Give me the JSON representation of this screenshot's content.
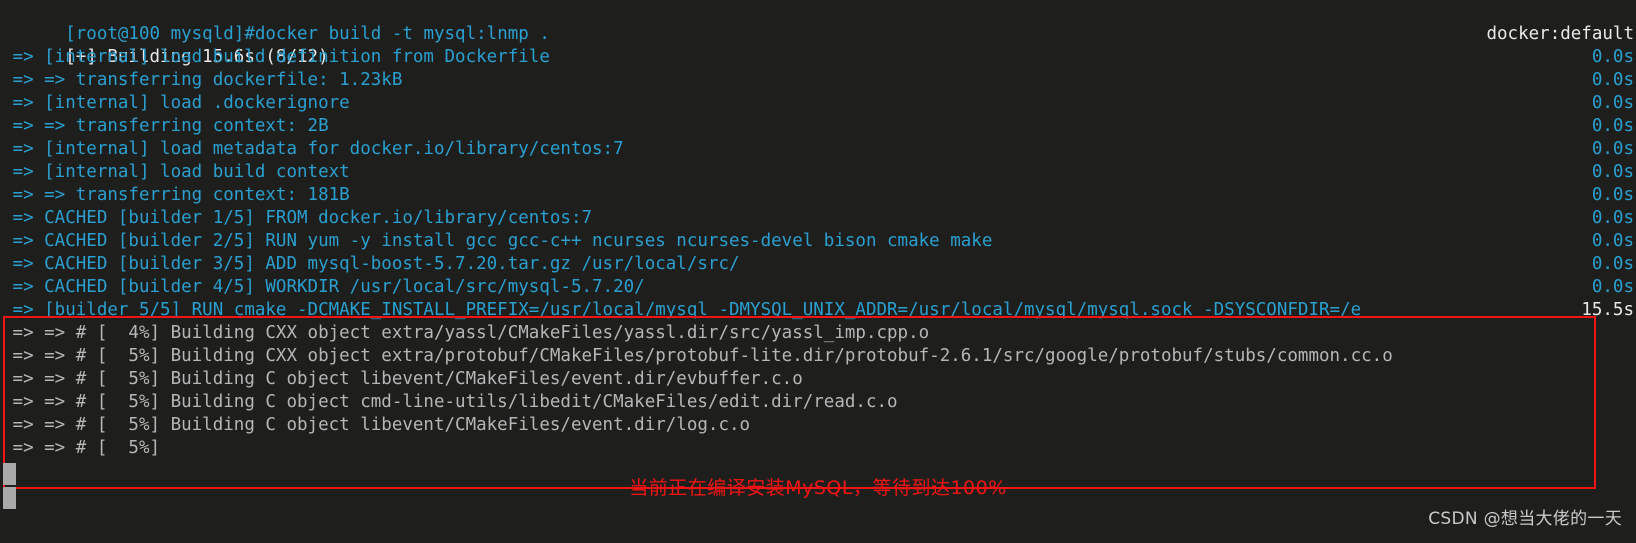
{
  "terminal": {
    "colors": {
      "background": "#1e1f1c",
      "cyan": "#2a9fd0",
      "white": "#e8e8e8",
      "gray": "#b6b6b6",
      "annotation_red": "#f01414"
    },
    "prompt_line": "[root@100 mysqld]#docker build -t mysql:lnmp .",
    "status_line": "[+] Building 15.6s (8/12)",
    "status_right": "docker:default",
    "lines": [
      {
        "text": " => [internal] load build definition from Dockerfile",
        "color": "cyan",
        "timing": "0.0s",
        "timing_color": "cyan"
      },
      {
        "text": " => => transferring dockerfile: 1.23kB",
        "color": "cyan",
        "timing": "0.0s",
        "timing_color": "cyan"
      },
      {
        "text": " => [internal] load .dockerignore",
        "color": "cyan",
        "timing": "0.0s",
        "timing_color": "cyan"
      },
      {
        "text": " => => transferring context: 2B",
        "color": "cyan",
        "timing": "0.0s",
        "timing_color": "cyan"
      },
      {
        "text": " => [internal] load metadata for docker.io/library/centos:7",
        "color": "cyan",
        "timing": "0.0s",
        "timing_color": "cyan"
      },
      {
        "text": " => [internal] load build context",
        "color": "cyan",
        "timing": "0.0s",
        "timing_color": "cyan"
      },
      {
        "text": " => => transferring context: 181B",
        "color": "cyan",
        "timing": "0.0s",
        "timing_color": "cyan"
      },
      {
        "text": " => CACHED [builder 1/5] FROM docker.io/library/centos:7",
        "color": "cyan",
        "timing": "0.0s",
        "timing_color": "cyan"
      },
      {
        "text": " => CACHED [builder 2/5] RUN yum -y install gcc gcc-c++ ncurses ncurses-devel bison cmake make",
        "color": "cyan",
        "timing": "0.0s",
        "timing_color": "cyan"
      },
      {
        "text": " => CACHED [builder 3/5] ADD mysql-boost-5.7.20.tar.gz /usr/local/src/",
        "color": "cyan",
        "timing": "0.0s",
        "timing_color": "cyan"
      },
      {
        "text": " => CACHED [builder 4/5] WORKDIR /usr/local/src/mysql-5.7.20/",
        "color": "cyan",
        "timing": "0.0s",
        "timing_color": "cyan"
      },
      {
        "text": " => [builder 5/5] RUN cmake -DCMAKE_INSTALL_PREFIX=/usr/local/mysql -DMYSQL_UNIX_ADDR=/usr/local/mysql/mysql.sock -DSYSCONFDIR=/e",
        "color": "cyan",
        "timing": "15.5s",
        "timing_color": "white"
      },
      {
        "text": " => => # [  4%] Building CXX object extra/yassl/CMakeFiles/yassl.dir/src/yassl_imp.cpp.o",
        "color": "gray",
        "timing": "",
        "timing_color": "gray"
      },
      {
        "text": " => => # [  5%] Building CXX object extra/protobuf/CMakeFiles/protobuf-lite.dir/protobuf-2.6.1/src/google/protobuf/stubs/common.cc.o",
        "color": "gray",
        "timing": "",
        "timing_color": "gray"
      },
      {
        "text": " => => # [  5%] Building C object libevent/CMakeFiles/event.dir/evbuffer.c.o",
        "color": "gray",
        "timing": "",
        "timing_color": "gray"
      },
      {
        "text": " => => # [  5%] Building C object cmd-line-utils/libedit/CMakeFiles/edit.dir/read.c.o",
        "color": "gray",
        "timing": "",
        "timing_color": "gray"
      },
      {
        "text": " => => # [  5%] Building C object libevent/CMakeFiles/event.dir/log.c.o",
        "color": "gray",
        "timing": "",
        "timing_color": "gray"
      },
      {
        "text": " => => # [  5%]",
        "color": "gray",
        "timing": "",
        "timing_color": "gray"
      }
    ]
  },
  "annotation": {
    "text": "当前正在编译安装MySQL，等待到达100%"
  },
  "watermark": {
    "text": "CSDN @想当大佬的一天"
  }
}
